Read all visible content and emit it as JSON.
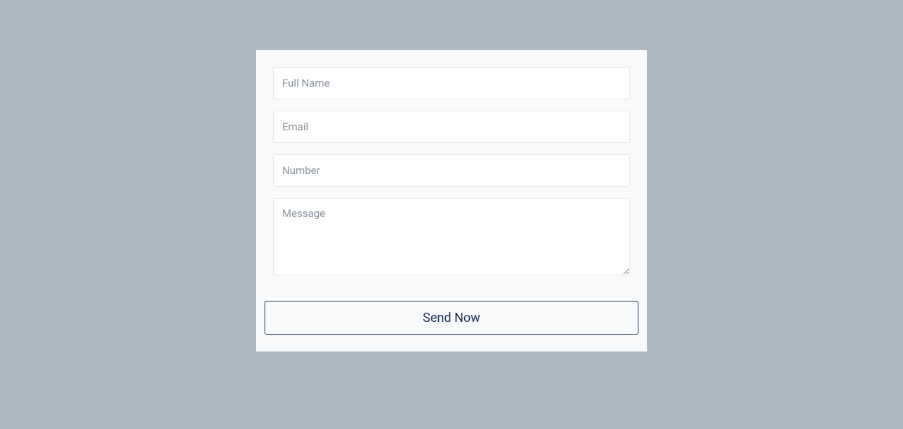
{
  "form": {
    "fullName": {
      "placeholder": "Full Name",
      "value": ""
    },
    "email": {
      "placeholder": "Email",
      "value": ""
    },
    "number": {
      "placeholder": "Number",
      "value": ""
    },
    "message": {
      "placeholder": "Message",
      "value": ""
    },
    "submitLabel": "Send Now"
  }
}
